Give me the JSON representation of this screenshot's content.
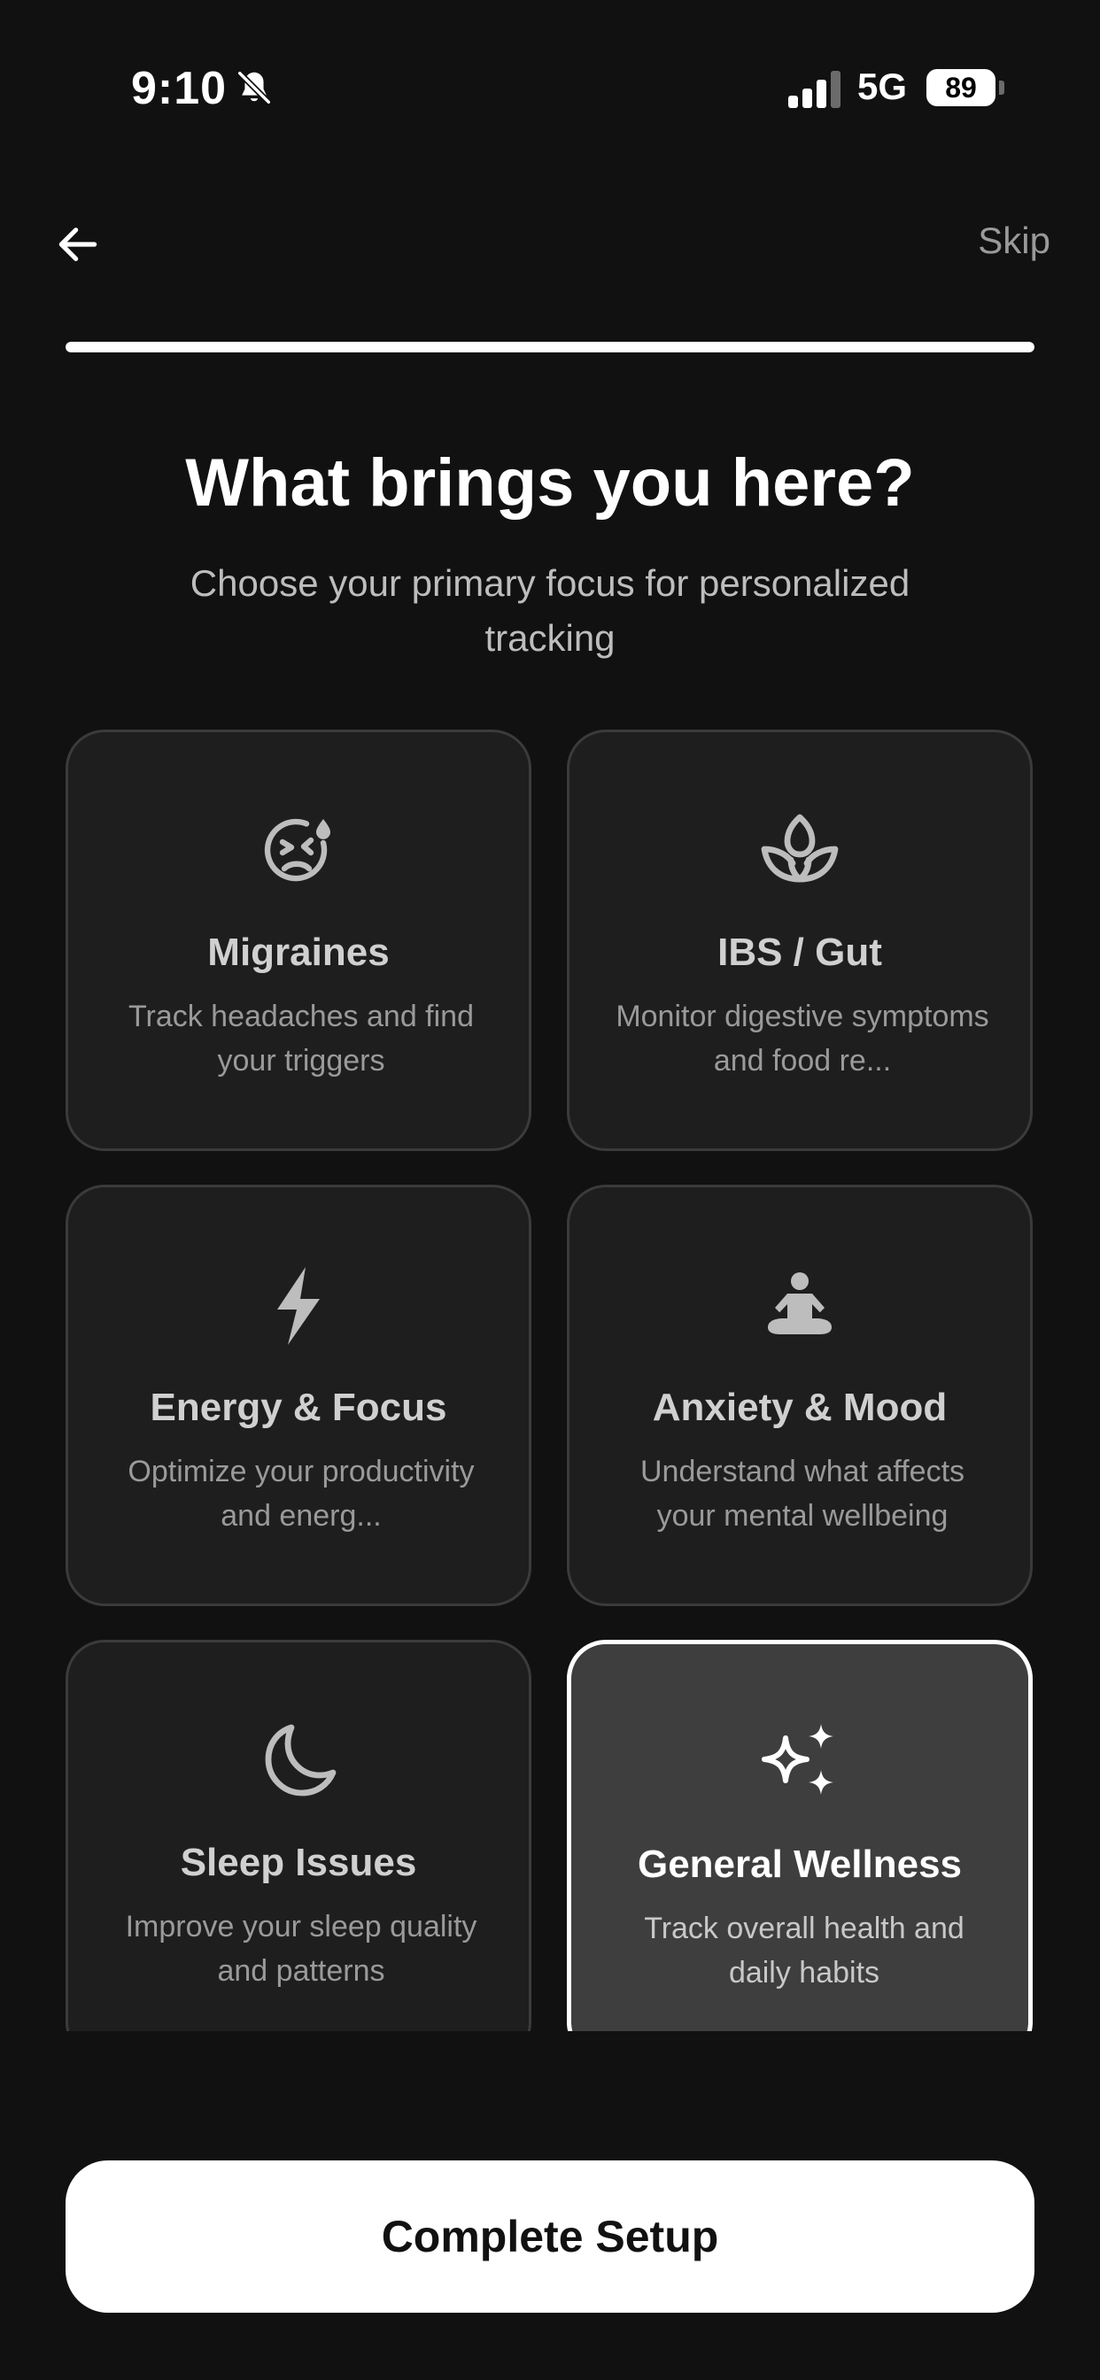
{
  "status_bar": {
    "time": "9:10",
    "network": "5G",
    "battery": "89"
  },
  "header": {
    "skip_label": "Skip"
  },
  "progress": {
    "value": 1.0
  },
  "title": "What brings you here?",
  "subtitle": "Choose your primary focus for personalized tracking",
  "options": [
    {
      "title": "Migraines",
      "description": "Track headaches and find your triggers",
      "icon": "dizzy-face-icon",
      "selected": false
    },
    {
      "title": "IBS / Gut",
      "description": "Monitor digestive symptoms and food re...",
      "icon": "lotus-icon",
      "selected": false
    },
    {
      "title": "Energy & Focus",
      "description": "Optimize your productivity and energ...",
      "icon": "lightning-icon",
      "selected": false
    },
    {
      "title": "Anxiety & Mood",
      "description": "Understand what affects your mental wellbeing",
      "icon": "meditation-icon",
      "selected": false
    },
    {
      "title": "Sleep Issues",
      "description": "Improve your sleep quality and patterns",
      "icon": "moon-icon",
      "selected": false
    },
    {
      "title": "General Wellness",
      "description": "Track overall health and daily habits",
      "icon": "sparkles-icon",
      "selected": true
    }
  ],
  "cta": {
    "label": "Complete Setup"
  },
  "colors": {
    "background": "#111111",
    "card": "#1e1e1e",
    "card_selected": "#3e3e3e",
    "accent": "#ffffff"
  }
}
